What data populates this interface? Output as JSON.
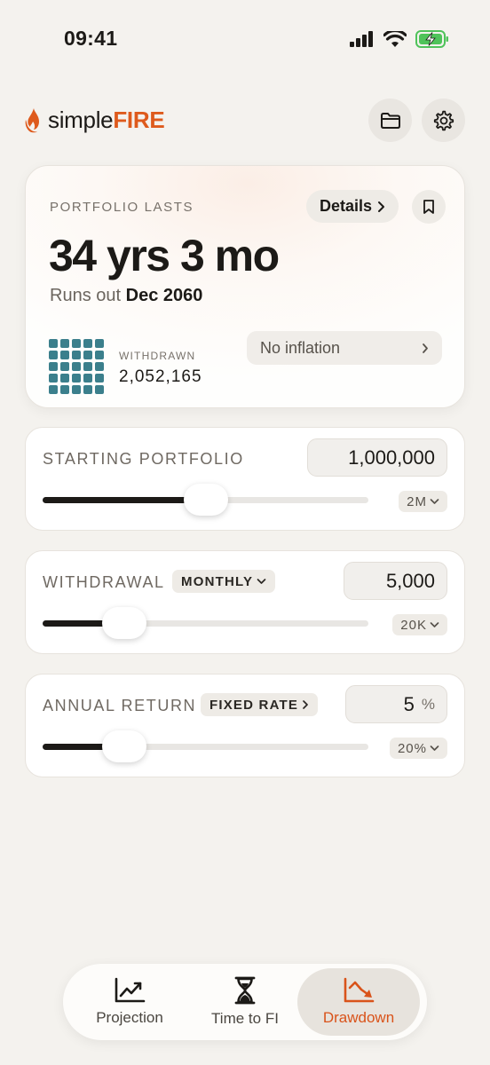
{
  "status_bar": {
    "time": "09:41"
  },
  "app": {
    "name_part1": "simple",
    "name_part2": "FIRE"
  },
  "header": {
    "folder_icon": "folder-icon",
    "settings_icon": "gear-icon"
  },
  "hero": {
    "label": "PORTFOLIO LASTS",
    "details_label": "Details",
    "value": "34 yrs 3 mo",
    "runs_out_prefix": "Runs out",
    "runs_out_date": "Dec 2060",
    "withdrawn_label": "WITHDRAWN",
    "withdrawn_value": "2,052,165",
    "inflation_label": "No inflation"
  },
  "controls": {
    "starting_portfolio": {
      "label": "STARTING PORTFOLIO",
      "value": "1,000,000",
      "max": "2M",
      "slider_fraction": 0.5
    },
    "withdrawal": {
      "label": "WITHDRAWAL",
      "frequency": "MONTHLY",
      "value": "5,000",
      "max": "20K",
      "slider_fraction": 0.25
    },
    "annual_return": {
      "label": "ANNUAL RETURN",
      "mode": "FIXED RATE",
      "value": "5",
      "unit": "%",
      "max": "20%",
      "slider_fraction": 0.25
    }
  },
  "tabs": [
    {
      "label": "Projection",
      "icon": "chart-up-icon",
      "active": false
    },
    {
      "label": "Time to FI",
      "icon": "hourglass-icon",
      "active": false
    },
    {
      "label": "Drawdown",
      "icon": "chart-down-icon",
      "active": true
    }
  ],
  "colors": {
    "accent": "#de5a1c",
    "grid": "#3b7f8c",
    "ink": "#1c1a17"
  }
}
